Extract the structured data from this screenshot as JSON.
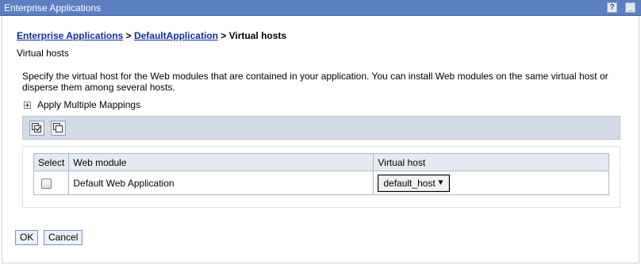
{
  "window": {
    "title": "Enterprise Applications",
    "help_label": "?",
    "minimize_label": "_"
  },
  "breadcrumb": {
    "link1": "Enterprise Applications",
    "sep1": " > ",
    "link2": "DefaultApplication",
    "sep2": " > ",
    "current": "Virtual hosts"
  },
  "page": {
    "name": "Virtual hosts",
    "description": "Specify the virtual host for the Web modules that are contained in your application. You can install Web modules on the same virtual host or disperse them among several hosts.",
    "apply_multiple_label": "Apply Multiple Mappings"
  },
  "toolbar": {
    "icons": [
      "select-all-icon",
      "deselect-all-icon"
    ]
  },
  "table": {
    "headers": [
      "Select",
      "Web module",
      "Virtual host"
    ],
    "rows": [
      {
        "checked": false,
        "web_module": "Default Web Application",
        "virtual_host": "default_host"
      }
    ]
  },
  "buttons": {
    "ok": "OK",
    "cancel": "Cancel"
  },
  "colors": {
    "titlebar": "#5b7fc2",
    "link": "#0b2f9e",
    "toolbar": "#d4dce9"
  }
}
